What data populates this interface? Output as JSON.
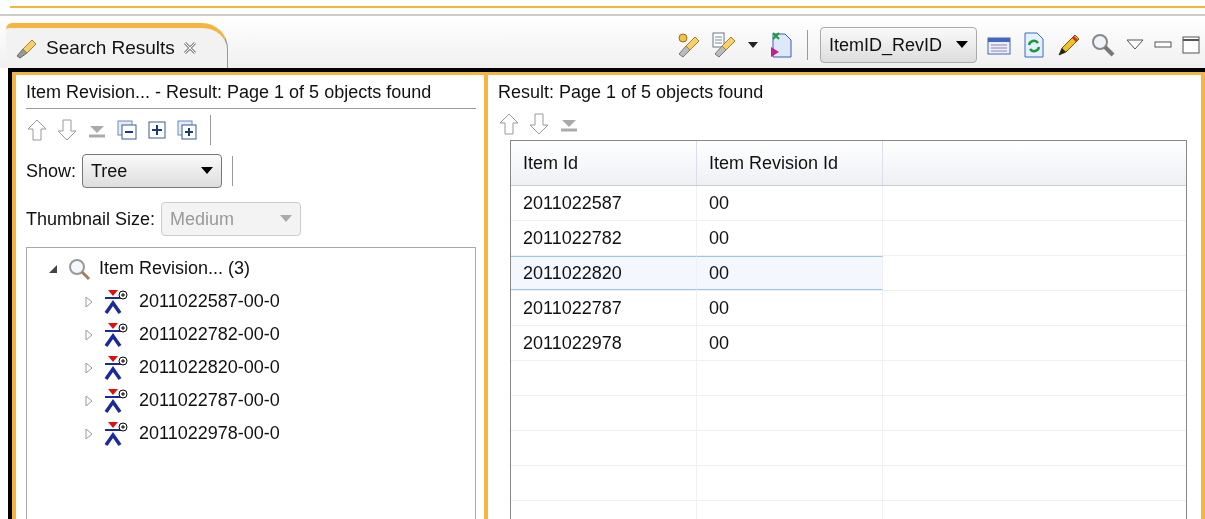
{
  "view_tab": {
    "title": "Search Results",
    "selected": true
  },
  "toolbar": {
    "query_dropdown": "ItemID_RevID"
  },
  "left_panel": {
    "title": "Item Revision... - Result: Page 1 of 5 objects found",
    "show": {
      "label": "Show:",
      "value": "Tree"
    },
    "thumbnail": {
      "label": "Thumbnail Size:",
      "value": "Medium",
      "disabled": true
    },
    "tree": [
      {
        "label": "Item Revision... (3)",
        "kind": "query",
        "expanded": true,
        "children": [
          {
            "label": "2011022587-00-0",
            "kind": "item",
            "expanded": false
          },
          {
            "label": "2011022782-00-0",
            "kind": "item",
            "expanded": false
          },
          {
            "label": "2011022820-00-0",
            "kind": "item",
            "expanded": false
          },
          {
            "label": "2011022787-00-0",
            "kind": "item",
            "expanded": false
          },
          {
            "label": "2011022978-00-0",
            "kind": "item",
            "expanded": false
          }
        ]
      }
    ]
  },
  "right_panel": {
    "title": "Result: Page 1 of 5 objects found",
    "table": {
      "columns": [
        "Item Id",
        "Item Revision Id"
      ],
      "rows": [
        {
          "cells": [
            "2011022587",
            "00"
          ],
          "selected": false
        },
        {
          "cells": [
            "2011022782",
            "00"
          ],
          "selected": false
        },
        {
          "cells": [
            "2011022820",
            "00"
          ],
          "selected": true
        },
        {
          "cells": [
            "2011022787",
            "00"
          ],
          "selected": false
        },
        {
          "cells": [
            "2011022978",
            "00"
          ],
          "selected": false
        }
      ]
    }
  }
}
